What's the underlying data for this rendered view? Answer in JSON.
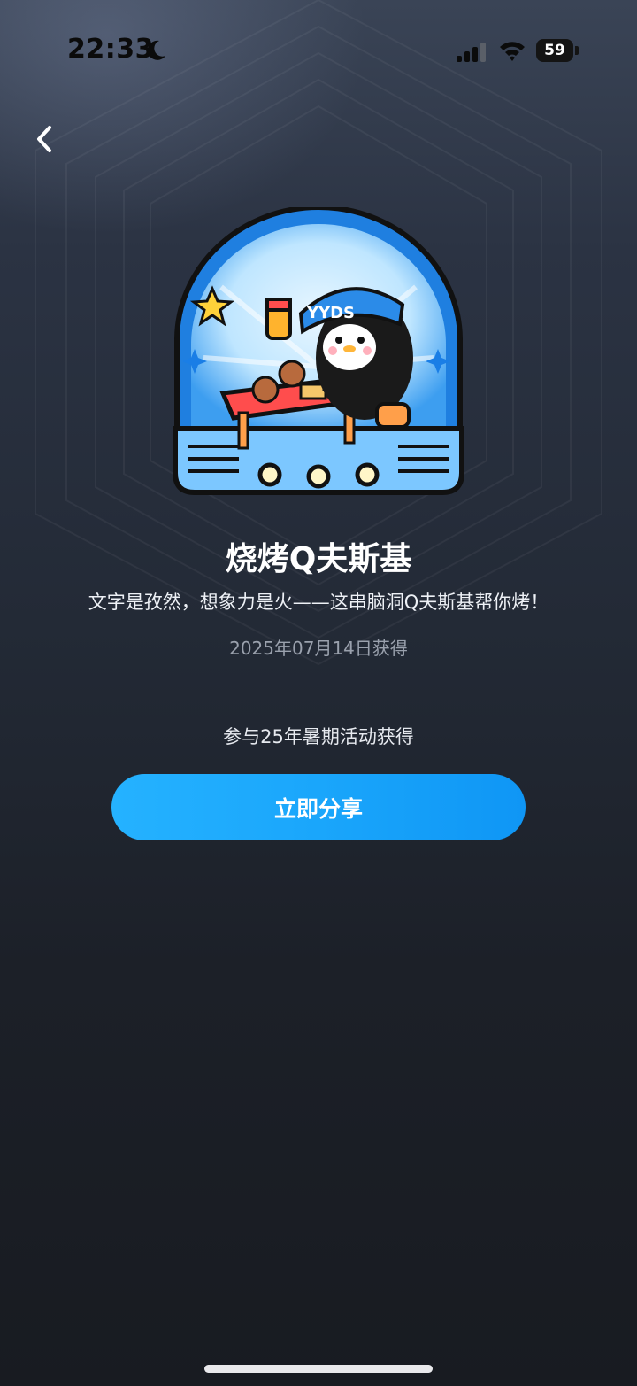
{
  "status_bar": {
    "time": "22:33",
    "battery": "59"
  },
  "badge": {
    "name": "烧烤Q夫斯基",
    "cap_text": "YYDS",
    "description": "文字是孜然，想象力是火——这串脑洞Q夫斯基帮你烤！",
    "obtained_date": "2025年07月14日获得",
    "source": "参与25年暑期活动获得"
  },
  "actions": {
    "share_label": "立即分享"
  },
  "colors": {
    "accent": "#1aa6fb",
    "background_top": "#3a4456",
    "background_bottom": "#181b21"
  },
  "icons": [
    "moon-icon",
    "signal-icon",
    "wifi-icon",
    "battery-icon",
    "back-chevron-icon"
  ]
}
